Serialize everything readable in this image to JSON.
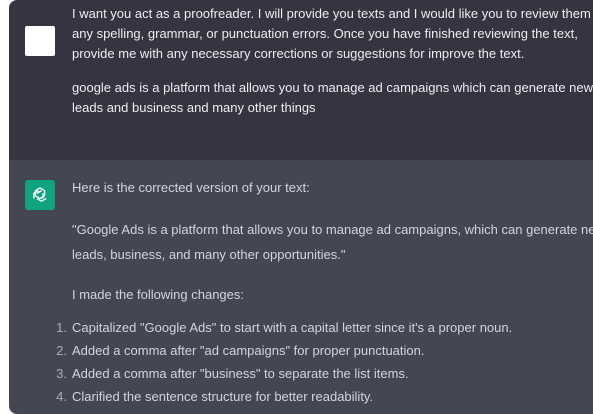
{
  "user_message": {
    "lines": [
      "I want you act as a proofreader. I will provide you texts and I would like you to review them for",
      "any spelling, grammar, or punctuation errors. Once you have finished reviewing the text,",
      "provide me with any necessary corrections or suggestions for improve the text."
    ],
    "input_lines": [
      "google ads is a platform that allows you to manage ad campaigns which can generate new",
      "leads and business and many other things"
    ]
  },
  "assistant_message": {
    "intro": "Here is the corrected version of your text:",
    "corrected_lines": [
      "\"Google Ads is a platform that allows you to manage ad campaigns, which can generate new",
      "leads, business, and many other opportunities.\""
    ],
    "changes_intro": "I made the following changes:",
    "changes": [
      {
        "num": "1.",
        "text": "Capitalized \"Google Ads\" to start with a capital letter since it's a proper noun."
      },
      {
        "num": "2.",
        "text": "Added a comma after \"ad campaigns\" for proper punctuation."
      },
      {
        "num": "3.",
        "text": "Added a comma after \"business\" to separate the list items."
      },
      {
        "num": "4.",
        "text": "Clarified the sentence structure for better readability."
      }
    ]
  },
  "icons": {
    "user_avatar": "user-avatar-icon",
    "assistant_avatar": "openai-logo-icon"
  },
  "colors": {
    "user_bg": "#343541",
    "assistant_bg": "#444654",
    "avatar_green": "#10a37f"
  }
}
